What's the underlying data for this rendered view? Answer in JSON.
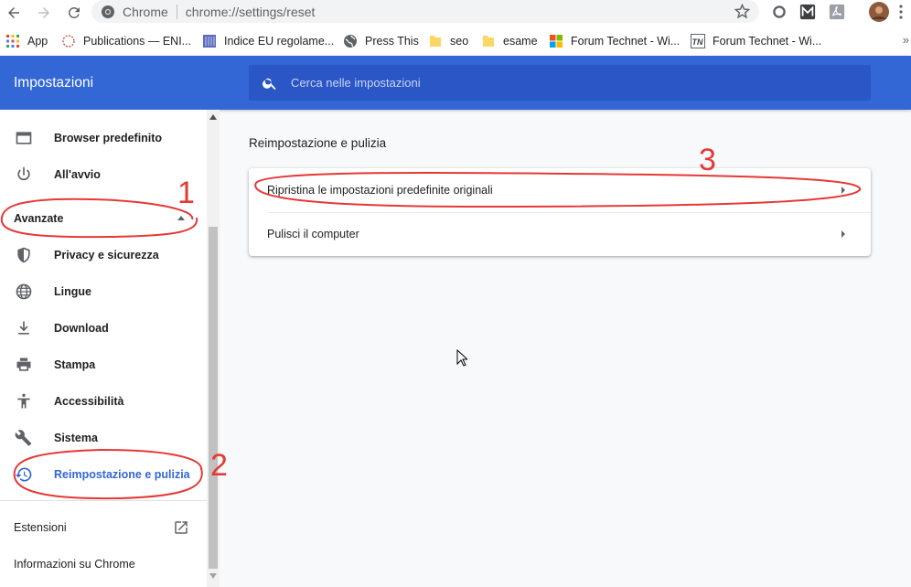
{
  "browser": {
    "chip_label": "Chrome",
    "url": "chrome://settings/reset"
  },
  "bookmarks": [
    {
      "label": "App",
      "icon": "apps-grid-icon"
    },
    {
      "label": "Publications — ENI...",
      "icon": "eni-icon"
    },
    {
      "label": "Indice EU regolame...",
      "icon": "book-icon"
    },
    {
      "label": "Press This",
      "icon": "globe-icon"
    },
    {
      "label": "seo",
      "icon": "folder-icon"
    },
    {
      "label": "esame",
      "icon": "folder-icon"
    },
    {
      "label": "Forum Technet - Wi...",
      "icon": "microsoft-icon"
    },
    {
      "label": "Forum Technet - Wi...",
      "icon": "tn-icon"
    }
  ],
  "bookmarks_more": "»",
  "header": {
    "title": "Impostazioni",
    "search_placeholder": "Cerca nelle impostazioni"
  },
  "sidebar": {
    "items_top": [
      {
        "label": "Browser predefinito",
        "icon": "browser-icon"
      },
      {
        "label": "All'avvio",
        "icon": "power-icon"
      }
    ],
    "advanced_label": "Avanzate",
    "items_advanced": [
      {
        "label": "Privacy e sicurezza",
        "icon": "shield-icon"
      },
      {
        "label": "Lingue",
        "icon": "globe-icon"
      },
      {
        "label": "Download",
        "icon": "download-icon"
      },
      {
        "label": "Stampa",
        "icon": "print-icon"
      },
      {
        "label": "Accessibilità",
        "icon": "accessibility-icon"
      },
      {
        "label": "Sistema",
        "icon": "wrench-icon"
      },
      {
        "label": "Reimpostazione e pulizia",
        "icon": "restore-icon",
        "active": true
      }
    ],
    "extensions_label": "Estensioni",
    "about_label": "Informazioni su Chrome"
  },
  "main": {
    "section_title": "Reimpostazione e pulizia",
    "rows": [
      {
        "label": "Ripristina le impostazioni predefinite originali"
      },
      {
        "label": "Pulisci il computer"
      }
    ]
  },
  "annotations": {
    "label_1": "1",
    "label_2": "2",
    "label_3": "3"
  },
  "colors": {
    "header_blue": "#3367d6",
    "search_blue": "#2a56c6",
    "annotation_red": "#e53935",
    "active_text": "#3367d6"
  }
}
